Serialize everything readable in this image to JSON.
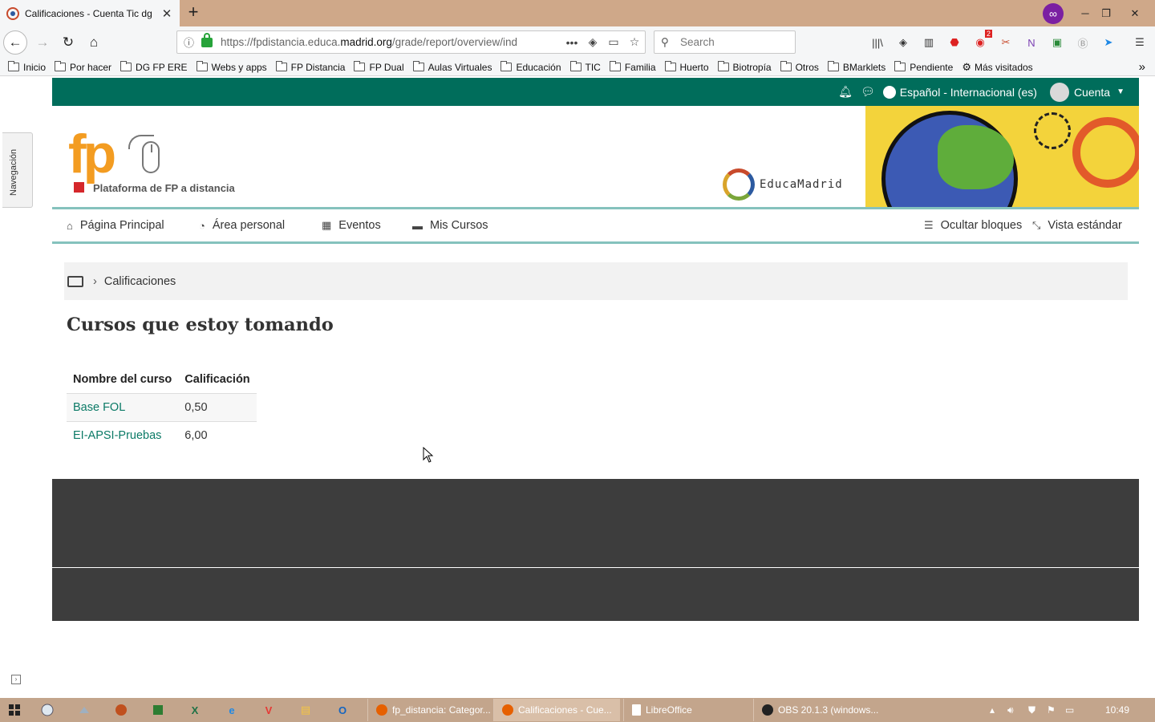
{
  "browser": {
    "tab_title": "Calificaciones - Cuenta Tic dg",
    "new_tab_icon": "plus-icon",
    "url_prefix": "https://fpdistancia.educa.",
    "url_domain": "madrid.org",
    "url_path": "/grade/report/overview/ind",
    "search_placeholder": "Search",
    "notification_count": "2",
    "bookmarks": [
      "Inicio",
      "Por hacer",
      "DG FP ERE",
      "Webs y apps",
      "FP Distancia",
      "FP Dual",
      "Aulas Virtuales",
      "Educación",
      "TIC",
      "Familia",
      "Huerto",
      "Biotropía",
      "Otros",
      "BMarklets",
      "Pendiente",
      "Más visitados"
    ]
  },
  "site": {
    "topbar": {
      "language": "Español - Internacional (es)",
      "account": "Cuenta",
      "color": "#006d5b"
    },
    "nav_drawer_label": "Navegación",
    "logo_text": "fp",
    "tagline": "Plataforma de FP a distancia",
    "educamadrid": "EducaMadrid",
    "menu": {
      "home": "Página Principal",
      "dashboard": "Área personal",
      "events": "Eventos",
      "courses": "Mis Cursos",
      "hide_blocks": "Ocultar bloques",
      "standard_view": "Vista estándar"
    },
    "breadcrumb": "Calificaciones",
    "heading": "Cursos que estoy tomando",
    "table": {
      "headers": [
        "Nombre del curso",
        "Calificación"
      ],
      "rows": [
        {
          "course": "Base FOL",
          "grade": "0,50"
        },
        {
          "course": "EI-APSI-Pruebas",
          "grade": "6,00"
        }
      ],
      "link_color": "#0b7a66"
    }
  },
  "taskbar": {
    "apps": [
      "explorer",
      "excel",
      "ie",
      "vivaldi",
      "files",
      "outlook"
    ],
    "windows": [
      {
        "label": "fp_distancia: Categor..."
      },
      {
        "label": "Calificaciones - Cue..."
      },
      {
        "label": "LibreOffice"
      },
      {
        "label": "OBS 20.1.3 (windows..."
      }
    ],
    "time": "10:49"
  }
}
